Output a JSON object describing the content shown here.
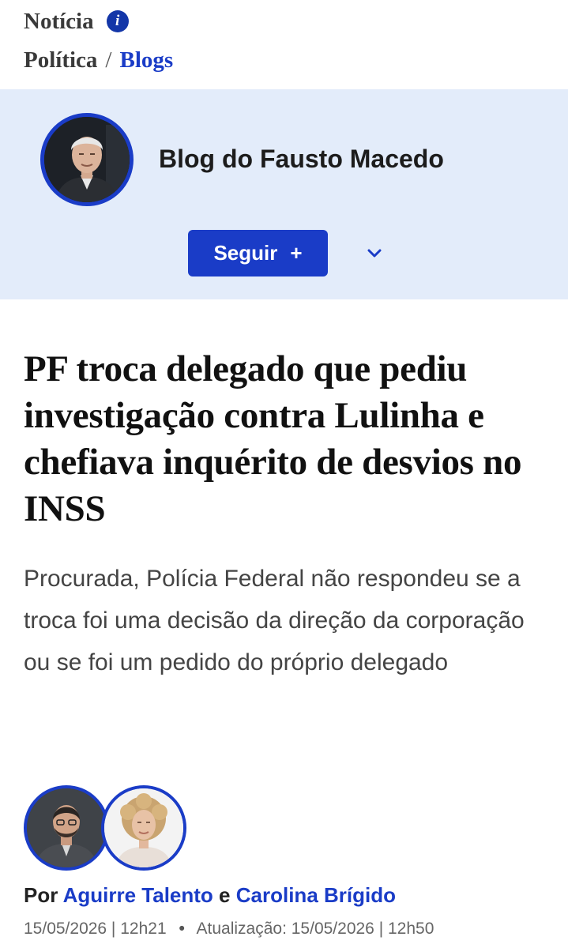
{
  "header": {
    "kicker": "Notícia",
    "info_icon": "info-icon",
    "breadcrumb_section": "Política",
    "breadcrumb_separator": "/",
    "breadcrumb_link": "Blogs"
  },
  "blog": {
    "name": "Blog do Fausto Macedo",
    "follow_label": "Seguir",
    "follow_plus": "+",
    "dropdown_icon": "chevron-down-icon"
  },
  "article": {
    "headline": "PF troca delegado que pediu investigação contra Lulinha e chefiava inquérito de desvios no INSS",
    "subtitle": "Procurada, Polícia Federal não respondeu se a troca foi uma decisão da direção da corporação ou se foi um pedido do próprio delegado"
  },
  "byline": {
    "prefix": "Por",
    "author1": "Aguirre Talento",
    "conjunction": "e",
    "author2": "Carolina Brígido"
  },
  "dates": {
    "published": "15/05/2026 | 12h21",
    "separator": "•",
    "updated": "Atualização: 15/05/2026 | 12h50"
  },
  "colors": {
    "accent": "#1a3cc7",
    "band_background": "#e3ecfa"
  }
}
